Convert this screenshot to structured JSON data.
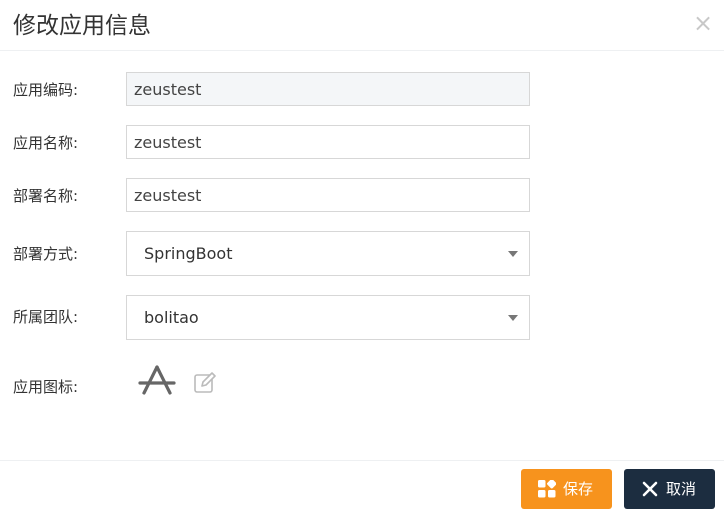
{
  "dialog": {
    "title": "修改应用信息",
    "close_glyph": "×"
  },
  "form": {
    "app_code": {
      "label": "应用编码:",
      "value": "zeustest",
      "readonly": true
    },
    "app_name": {
      "label": "应用名称:",
      "value": "zeustest"
    },
    "deploy_name": {
      "label": "部署名称:",
      "value": "zeustest"
    },
    "deploy_method": {
      "label": "部署方式:",
      "selected": "SpringBoot"
    },
    "team": {
      "label": "所属团队:",
      "selected": "bolitao"
    },
    "app_icon": {
      "label": "应用图标:",
      "icon": "app-store-icon",
      "edit_icon": "edit-icon"
    }
  },
  "footer": {
    "save_label": "保存",
    "save_icon": "grid-icon",
    "cancel_label": "取消",
    "cancel_icon": "close-icon"
  },
  "colors": {
    "save_bg": "#f7931d",
    "cancel_bg": "#1c2d40",
    "title_text": "#333333"
  }
}
